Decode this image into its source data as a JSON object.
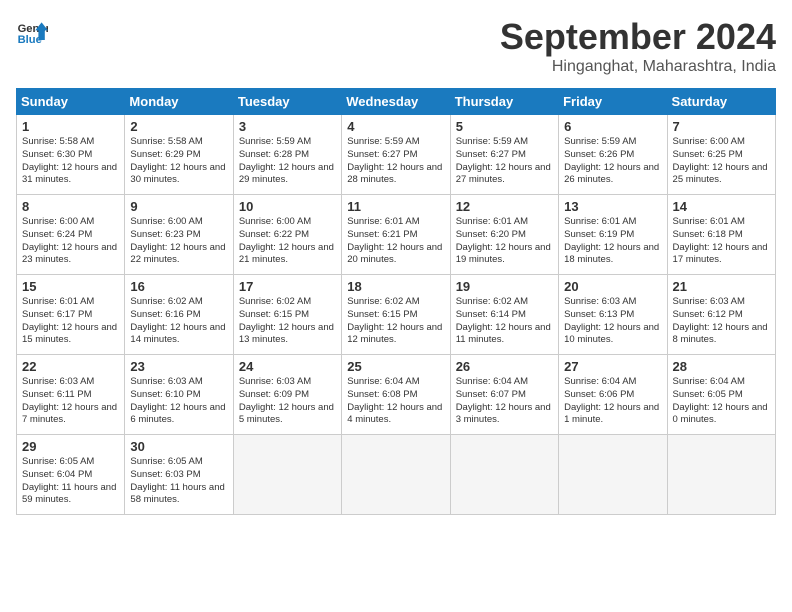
{
  "logo": {
    "line1": "General",
    "line2": "Blue"
  },
  "title": "September 2024",
  "subtitle": "Hinganghat, Maharashtra, India",
  "weekdays": [
    "Sunday",
    "Monday",
    "Tuesday",
    "Wednesday",
    "Thursday",
    "Friday",
    "Saturday"
  ],
  "weeks": [
    [
      {
        "day": 1,
        "sunrise": "5:58 AM",
        "sunset": "6:30 PM",
        "daylight": "12 hours and 31 minutes."
      },
      {
        "day": 2,
        "sunrise": "5:58 AM",
        "sunset": "6:29 PM",
        "daylight": "12 hours and 30 minutes."
      },
      {
        "day": 3,
        "sunrise": "5:59 AM",
        "sunset": "6:28 PM",
        "daylight": "12 hours and 29 minutes."
      },
      {
        "day": 4,
        "sunrise": "5:59 AM",
        "sunset": "6:27 PM",
        "daylight": "12 hours and 28 minutes."
      },
      {
        "day": 5,
        "sunrise": "5:59 AM",
        "sunset": "6:27 PM",
        "daylight": "12 hours and 27 minutes."
      },
      {
        "day": 6,
        "sunrise": "5:59 AM",
        "sunset": "6:26 PM",
        "daylight": "12 hours and 26 minutes."
      },
      {
        "day": 7,
        "sunrise": "6:00 AM",
        "sunset": "6:25 PM",
        "daylight": "12 hours and 25 minutes."
      }
    ],
    [
      {
        "day": 8,
        "sunrise": "6:00 AM",
        "sunset": "6:24 PM",
        "daylight": "12 hours and 23 minutes."
      },
      {
        "day": 9,
        "sunrise": "6:00 AM",
        "sunset": "6:23 PM",
        "daylight": "12 hours and 22 minutes."
      },
      {
        "day": 10,
        "sunrise": "6:00 AM",
        "sunset": "6:22 PM",
        "daylight": "12 hours and 21 minutes."
      },
      {
        "day": 11,
        "sunrise": "6:01 AM",
        "sunset": "6:21 PM",
        "daylight": "12 hours and 20 minutes."
      },
      {
        "day": 12,
        "sunrise": "6:01 AM",
        "sunset": "6:20 PM",
        "daylight": "12 hours and 19 minutes."
      },
      {
        "day": 13,
        "sunrise": "6:01 AM",
        "sunset": "6:19 PM",
        "daylight": "12 hours and 18 minutes."
      },
      {
        "day": 14,
        "sunrise": "6:01 AM",
        "sunset": "6:18 PM",
        "daylight": "12 hours and 17 minutes."
      }
    ],
    [
      {
        "day": 15,
        "sunrise": "6:01 AM",
        "sunset": "6:17 PM",
        "daylight": "12 hours and 15 minutes."
      },
      {
        "day": 16,
        "sunrise": "6:02 AM",
        "sunset": "6:16 PM",
        "daylight": "12 hours and 14 minutes."
      },
      {
        "day": 17,
        "sunrise": "6:02 AM",
        "sunset": "6:15 PM",
        "daylight": "12 hours and 13 minutes."
      },
      {
        "day": 18,
        "sunrise": "6:02 AM",
        "sunset": "6:15 PM",
        "daylight": "12 hours and 12 minutes."
      },
      {
        "day": 19,
        "sunrise": "6:02 AM",
        "sunset": "6:14 PM",
        "daylight": "12 hours and 11 minutes."
      },
      {
        "day": 20,
        "sunrise": "6:03 AM",
        "sunset": "6:13 PM",
        "daylight": "12 hours and 10 minutes."
      },
      {
        "day": 21,
        "sunrise": "6:03 AM",
        "sunset": "6:12 PM",
        "daylight": "12 hours and 8 minutes."
      }
    ],
    [
      {
        "day": 22,
        "sunrise": "6:03 AM",
        "sunset": "6:11 PM",
        "daylight": "12 hours and 7 minutes."
      },
      {
        "day": 23,
        "sunrise": "6:03 AM",
        "sunset": "6:10 PM",
        "daylight": "12 hours and 6 minutes."
      },
      {
        "day": 24,
        "sunrise": "6:03 AM",
        "sunset": "6:09 PM",
        "daylight": "12 hours and 5 minutes."
      },
      {
        "day": 25,
        "sunrise": "6:04 AM",
        "sunset": "6:08 PM",
        "daylight": "12 hours and 4 minutes."
      },
      {
        "day": 26,
        "sunrise": "6:04 AM",
        "sunset": "6:07 PM",
        "daylight": "12 hours and 3 minutes."
      },
      {
        "day": 27,
        "sunrise": "6:04 AM",
        "sunset": "6:06 PM",
        "daylight": "12 hours and 1 minute."
      },
      {
        "day": 28,
        "sunrise": "6:04 AM",
        "sunset": "6:05 PM",
        "daylight": "12 hours and 0 minutes."
      }
    ],
    [
      {
        "day": 29,
        "sunrise": "6:05 AM",
        "sunset": "6:04 PM",
        "daylight": "11 hours and 59 minutes."
      },
      {
        "day": 30,
        "sunrise": "6:05 AM",
        "sunset": "6:03 PM",
        "daylight": "11 hours and 58 minutes."
      },
      null,
      null,
      null,
      null,
      null
    ]
  ]
}
